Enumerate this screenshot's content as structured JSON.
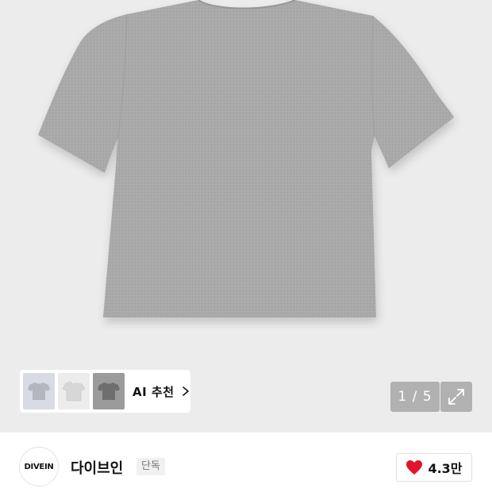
{
  "gallery": {
    "counter_text": "1 / 5",
    "ai_recommend_label": "AI 추천",
    "image_icon": "tshirt-image",
    "expand_icon": "expand-arrows-icon"
  },
  "brand": {
    "logo_text": "DIVEIN",
    "name": "다이브인",
    "badge": "단독"
  },
  "like": {
    "count": "4.3만",
    "icon": "heart-icon",
    "color": "#e0142a"
  },
  "colors": {
    "image_bg": "#ececec",
    "tshirt": "#a7a7a7"
  }
}
